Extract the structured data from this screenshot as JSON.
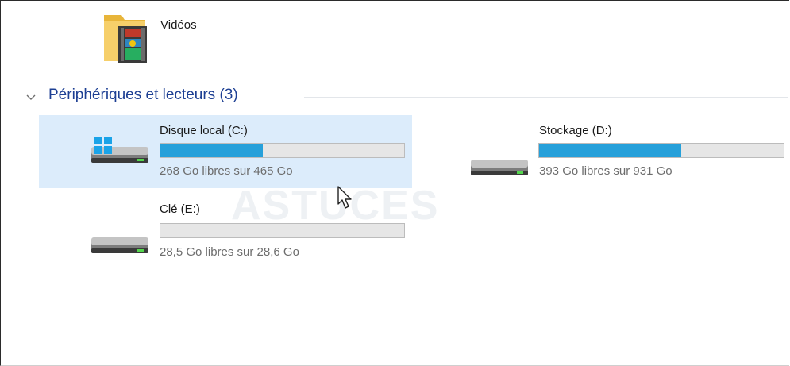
{
  "library": {
    "videos": {
      "label": "Vidéos",
      "icon": "videos-folder-icon"
    }
  },
  "group": {
    "title": "Périphériques et lecteurs (3)",
    "chevron_icon": "chevron-down-icon"
  },
  "drives": [
    {
      "name": "Disque local (C:)",
      "free_text": "268 Go libres sur 465 Go",
      "used_fraction": 0.42,
      "icon": "windows-system-drive-icon",
      "selected": true
    },
    {
      "name": "Stockage (D:)",
      "free_text": "393 Go libres sur 931 Go",
      "used_fraction": 0.58,
      "icon": "hard-drive-icon",
      "selected": false
    },
    {
      "name": "Clé (E:)",
      "free_text": "28,5 Go libres sur 28,6 Go",
      "used_fraction": 0.0,
      "icon": "usb-drive-icon",
      "selected": false
    }
  ],
  "watermark": "ASTUCES",
  "colors": {
    "bar_fill": "#26a0da",
    "selection": "#dcecfb",
    "group_title": "#1d3f93"
  }
}
